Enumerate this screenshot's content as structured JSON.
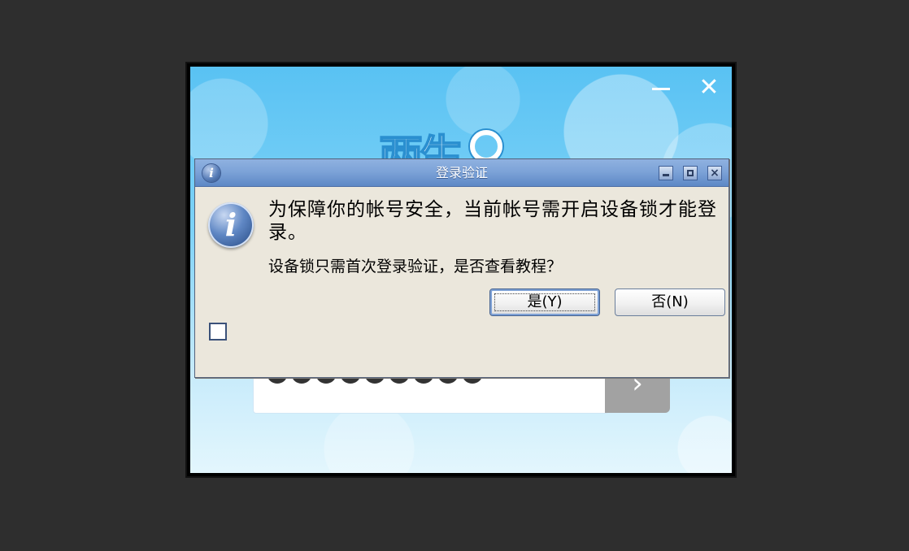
{
  "background_window": {
    "close_glyph": "✕",
    "logo_glyph": "两生",
    "password_dot_count": 9,
    "login_arrow_glyph": "›"
  },
  "dialog": {
    "title": "登录验证",
    "title_icon_glyph": "i",
    "info_icon_glyph": "i",
    "message_main": "为保障你的帐号安全，当前帐号需开启设备锁才能登录。",
    "message_question": "设备锁只需首次登录验证，是否查看教程？",
    "yes_label": "是(Y)",
    "no_label": "否(N)",
    "close_glyph": "×",
    "checkbox_checked": false
  },
  "colors": {
    "desktop_bg": "#2e2e2e",
    "dialog_bg": "#ebe7dc",
    "titlebar_accent": "#7da3d8",
    "app_sky": "#59c2f3"
  }
}
